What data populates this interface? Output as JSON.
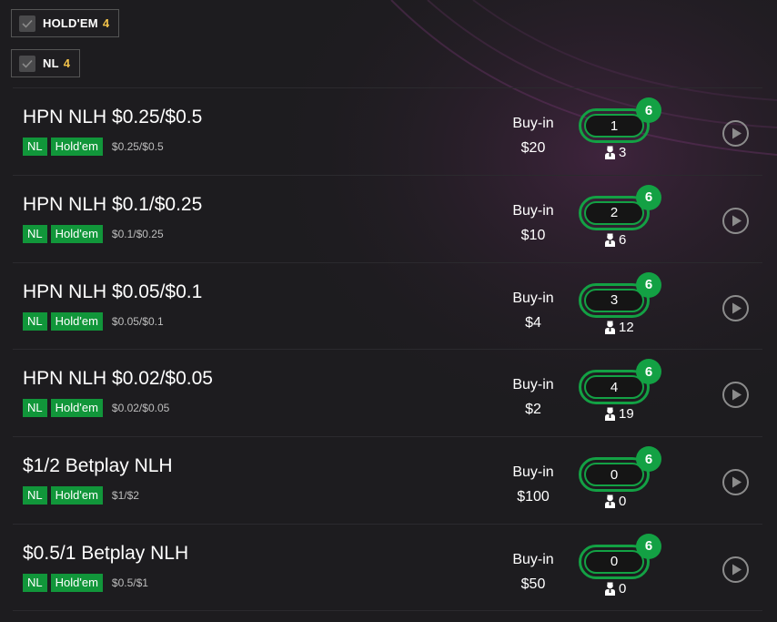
{
  "filters": [
    {
      "label": "HOLD'EM",
      "count": "4"
    },
    {
      "label": "NL",
      "count": "4"
    }
  ],
  "games": [
    {
      "title": "HPN NLH $0.25/$0.5",
      "tags": [
        "NL",
        "Hold'em"
      ],
      "stakes": "$0.25/$0.5",
      "buyin_label": "Buy-in",
      "buyin": "$20",
      "tables": "1",
      "seats": "6",
      "players": "3"
    },
    {
      "title": "HPN NLH $0.1/$0.25",
      "tags": [
        "NL",
        "Hold'em"
      ],
      "stakes": "$0.1/$0.25",
      "buyin_label": "Buy-in",
      "buyin": "$10",
      "tables": "2",
      "seats": "6",
      "players": "6"
    },
    {
      "title": "HPN NLH $0.05/$0.1",
      "tags": [
        "NL",
        "Hold'em"
      ],
      "stakes": "$0.05/$0.1",
      "buyin_label": "Buy-in",
      "buyin": "$4",
      "tables": "3",
      "seats": "6",
      "players": "12"
    },
    {
      "title": "HPN NLH $0.02/$0.05",
      "tags": [
        "NL",
        "Hold'em"
      ],
      "stakes": "$0.02/$0.05",
      "buyin_label": "Buy-in",
      "buyin": "$2",
      "tables": "4",
      "seats": "6",
      "players": "19"
    },
    {
      "title": "$1/2 Betplay NLH",
      "tags": [
        "NL",
        "Hold'em"
      ],
      "stakes": "$1/$2",
      "buyin_label": "Buy-in",
      "buyin": "$100",
      "tables": "0",
      "seats": "6",
      "players": "0"
    },
    {
      "title": "$0.5/1 Betplay NLH",
      "tags": [
        "NL",
        "Hold'em"
      ],
      "stakes": "$0.5/$1",
      "buyin_label": "Buy-in",
      "buyin": "$50",
      "tables": "0",
      "seats": "6",
      "players": "0"
    }
  ],
  "colors": {
    "accent_green": "#13a144",
    "count_yellow": "#f2c24a",
    "background": "#1d1c1f"
  }
}
